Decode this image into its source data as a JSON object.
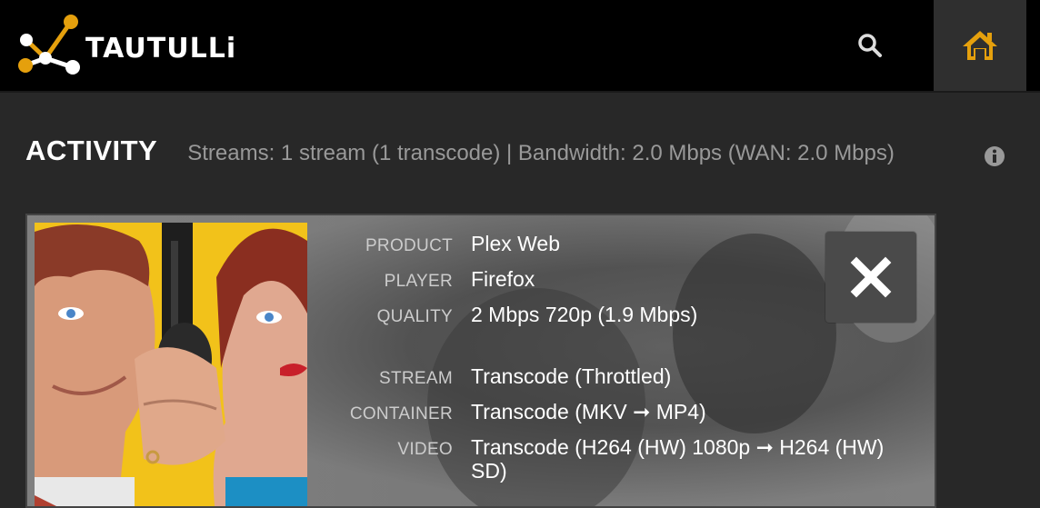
{
  "navbar": {
    "brand_name": "TAUTULLi",
    "search_icon": "search-icon",
    "home_icon": "home-icon",
    "accent_color": "#e5a00d"
  },
  "activity": {
    "title": "ACTIVITY",
    "summary": "Streams: 1 stream (1 transcode) | Bandwidth: 2.0 Mbps (WAN: 2.0 Mbps)",
    "info_icon": "info-icon"
  },
  "stream": {
    "details": [
      {
        "label": "PRODUCT",
        "value": "Plex Web"
      },
      {
        "label": "PLAYER",
        "value": "Firefox"
      },
      {
        "label": "QUALITY",
        "value": "2 Mbps 720p (1.9 Mbps)"
      },
      {
        "label": "STREAM",
        "value": "Transcode (Throttled)"
      },
      {
        "label": "CONTAINER",
        "value": "Transcode (MKV ➞ MP4)"
      },
      {
        "label": "VIDEO",
        "value": "Transcode (H264 (HW) 1080p ➞ H264 (HW) SD)"
      }
    ],
    "close_icon": "close-icon"
  }
}
